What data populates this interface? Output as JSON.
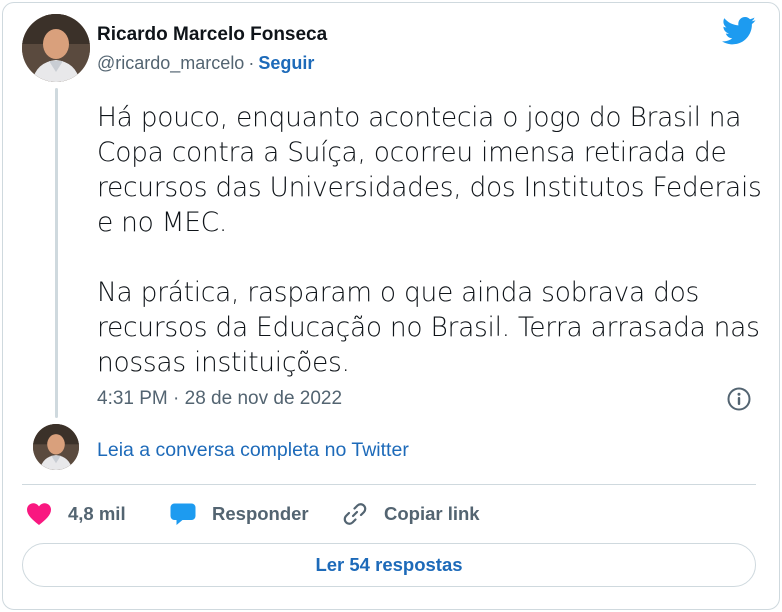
{
  "author": {
    "name": "Ricardo Marcelo Fonseca",
    "handle": "@ricardo_marcelo",
    "separator": "·",
    "follow_label": "Seguir"
  },
  "tweet": {
    "paragraphs": [
      "Há pouco, enquanto acontecia o jogo do Brasil na Copa contra a Suíça, ocorreu imensa retirada de recursos das Universidades, dos Institutos Federais e no MEC.",
      "Na prática, rasparam o que ainda sobrava dos recursos da Educação no Brasil. Terra arrasada nas nossas instituições."
    ],
    "timestamp": "4:31 PM · 28 de nov de 2022"
  },
  "conversation_link": "Leia a conversa completa no Twitter",
  "actions": {
    "like_count": "4,8 mil",
    "reply_label": "Responder",
    "copy_label": "Copiar link"
  },
  "read_replies_label": "Ler 54 respostas",
  "icons": {
    "brand": "twitter-bird-icon",
    "info": "info-icon",
    "like": "heart-icon",
    "reply": "speech-bubble-icon",
    "copy": "link-icon"
  },
  "colors": {
    "twitter_blue": "#1d9bf0",
    "link_blue": "#1d6ab9",
    "like_pink": "#f91880",
    "text": "#0f1419",
    "muted": "#536471",
    "border": "#cfd9de"
  }
}
